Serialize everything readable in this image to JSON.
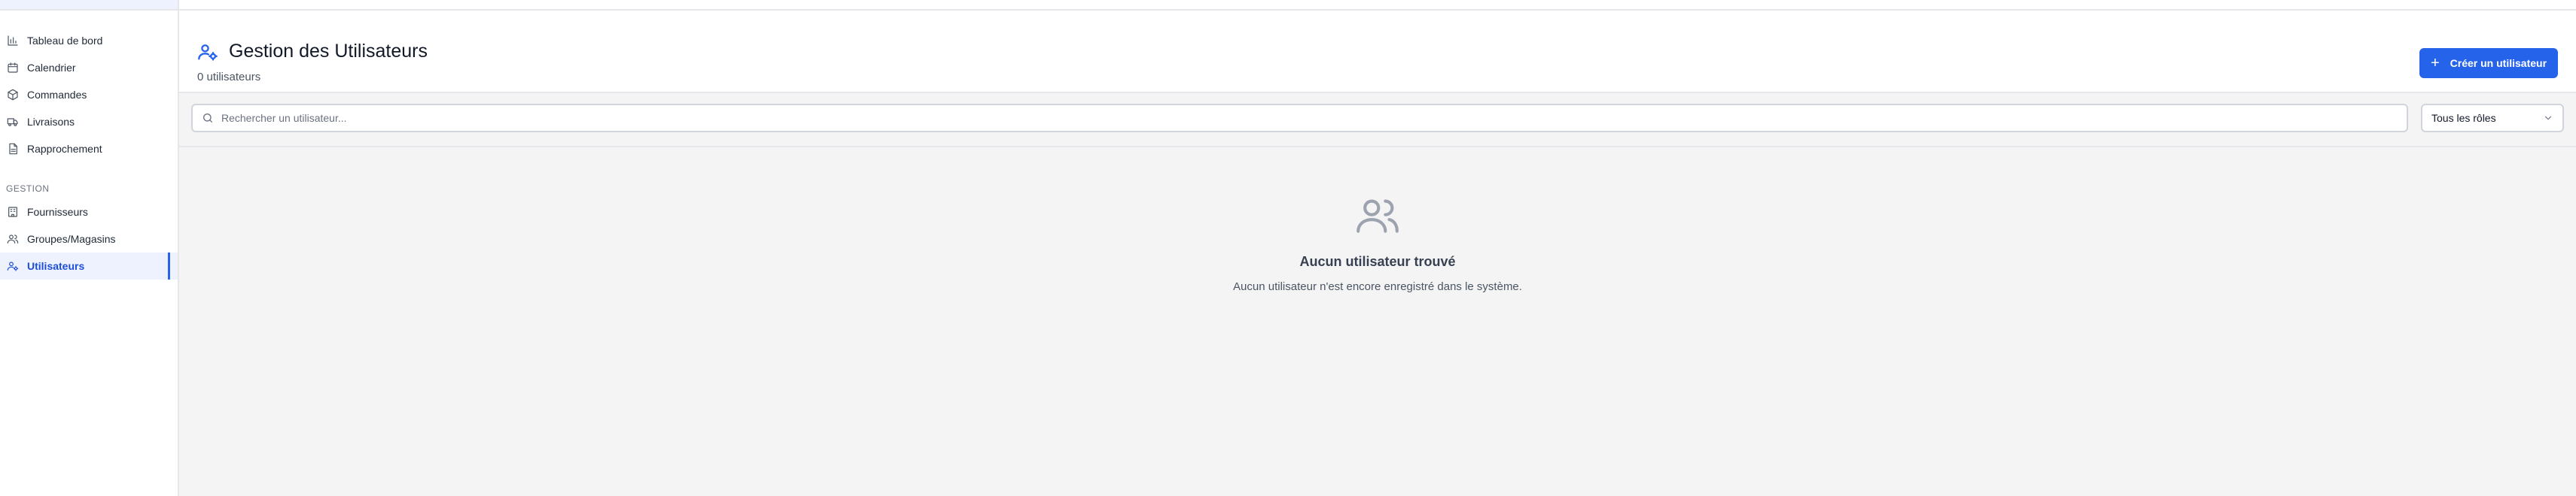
{
  "sidebar": {
    "items": [
      {
        "label": "Tableau de bord",
        "icon": "chart-icon"
      },
      {
        "label": "Calendrier",
        "icon": "calendar-icon"
      },
      {
        "label": "Commandes",
        "icon": "package-icon"
      },
      {
        "label": "Livraisons",
        "icon": "truck-icon"
      },
      {
        "label": "Rapprochement",
        "icon": "document-icon"
      }
    ],
    "section_label": "GESTION",
    "gestion_items": [
      {
        "label": "Fournisseurs",
        "icon": "building-icon"
      },
      {
        "label": "Groupes/Magasins",
        "icon": "users-icon"
      },
      {
        "label": "Utilisateurs",
        "icon": "user-cog-icon",
        "active": true
      }
    ]
  },
  "header": {
    "title": "Gestion des Utilisateurs",
    "title_icon": "user-cog-icon",
    "subtitle": "0 utilisateurs",
    "create_button": {
      "plus": "+",
      "label": "Créer un utilisateur"
    }
  },
  "filters": {
    "search": {
      "placeholder": "Rechercher un utilisateur...",
      "value": ""
    },
    "role_select": {
      "selected": "Tous les rôles"
    }
  },
  "empty_state": {
    "icon": "users-icon",
    "title": "Aucun utilisateur trouvé",
    "description": "Aucun utilisateur n'est encore enregistré dans le système."
  },
  "colors": {
    "accent": "#2563eb",
    "active_bg": "#eef2ff",
    "page_bg": "#f4f4f5"
  }
}
